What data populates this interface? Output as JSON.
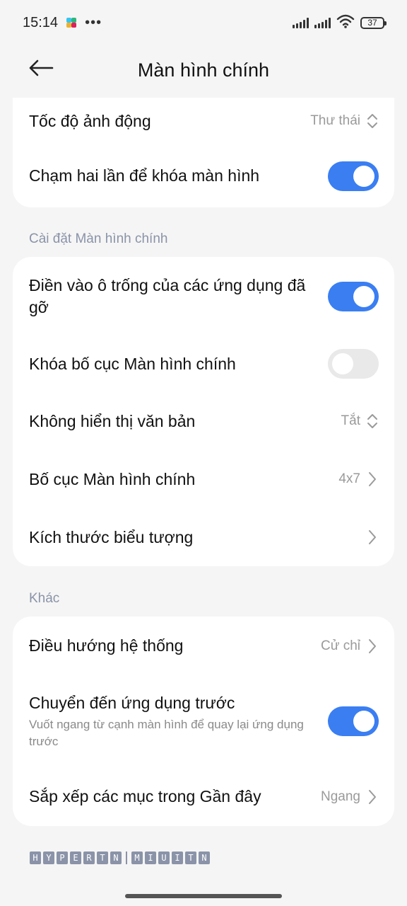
{
  "status_bar": {
    "time": "15:14",
    "more": "•••",
    "battery": "37"
  },
  "header": {
    "title": "Màn hình chính",
    "back_icon": "arrow-left-icon"
  },
  "card1": {
    "animation_speed": {
      "label": "Tốc độ ảnh động",
      "value": "Thư thái"
    },
    "double_tap_lock": {
      "label": "Chạm hai lần để khóa màn hình",
      "on": true
    }
  },
  "section_home": {
    "label": "Cài đặt Màn hình chính"
  },
  "card2": {
    "fill_gaps": {
      "label": "Điền vào ô trống của các ứng dụng đã gỡ",
      "on": true
    },
    "lock_layout": {
      "label": "Khóa bố cục Màn hình chính",
      "on": false
    },
    "hide_text": {
      "label": "Không hiển thị văn bản",
      "value": "Tắt"
    },
    "layout": {
      "label": "Bố cục Màn hình chính",
      "value": "4x7"
    },
    "icon_size": {
      "label": "Kích thước biểu tượng"
    }
  },
  "section_other": {
    "label": "Khác"
  },
  "card3": {
    "system_nav": {
      "label": "Điều hướng hệ thống",
      "value": "Cử chỉ"
    },
    "prev_app": {
      "label": "Chuyển đến ứng dụng trước",
      "sub": "Vuốt ngang từ cạnh màn hình để quay lại ứng dụng trước",
      "on": true
    },
    "recents_sort": {
      "label": "Sắp xếp các mục trong Gần đây",
      "value": "Ngang"
    }
  },
  "watermark": {
    "left": [
      "H",
      "Y",
      "P",
      "E",
      "R",
      "T",
      "N"
    ],
    "right": [
      "M",
      "I",
      "U",
      "I",
      "T",
      "N"
    ]
  },
  "colors": {
    "accent": "#3a7ef2",
    "section_label": "#8a93a8",
    "background": "#f5f5f5"
  }
}
